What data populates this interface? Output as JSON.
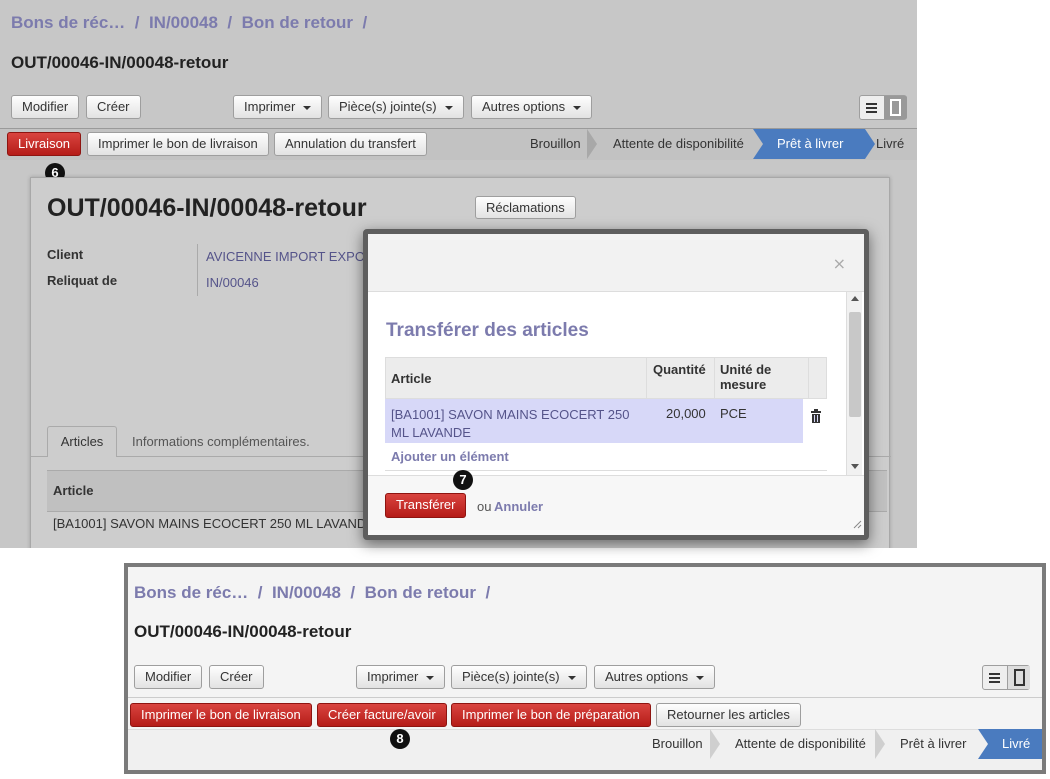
{
  "top": {
    "breadcrumb": [
      "Bons de réc…",
      "IN/00048",
      "Bon de retour"
    ],
    "record_title": "OUT/00046-IN/00048-retour",
    "buttons": {
      "modifier": "Modifier",
      "creer": "Créer",
      "imprimer": "Imprimer",
      "pieces": "Pièce(s) jointe(s)",
      "autres": "Autres options"
    },
    "actions": {
      "livraison": "Livraison",
      "imprimer_bon": "Imprimer le bon de livraison",
      "annulation": "Annulation du transfert"
    },
    "steps": [
      "Brouillon",
      "Attente de disponibilité",
      "Prêt à livrer",
      "Livré"
    ],
    "badge6": "6",
    "form": {
      "title": "OUT/00046-IN/00048-retour",
      "reclamations": "Réclamations",
      "client_label": "Client",
      "client_value": "AVICENNE IMPORT EXPOR",
      "reliquat_label": "Reliquat de",
      "reliquat_value": "IN/00046",
      "tabs": [
        "Articles",
        "Informations complémentaires."
      ],
      "table_header": "Article",
      "table_row": "[BA1001] SAVON MAINS ECOCERT 250 ML LAVAND"
    }
  },
  "modal": {
    "close": "×",
    "title": "Transférer des articles",
    "columns": {
      "article": "Article",
      "quantite": "Quantité",
      "unite1": "Unité de",
      "unite2": "mesure"
    },
    "row": {
      "article1": "[BA1001] SAVON MAINS ECOCERT 250",
      "article2": "ML LAVANDE",
      "quantite": "20,000",
      "unite": "PCE"
    },
    "add": "Ajouter un élément",
    "badge7": "7",
    "transferer": "Transférer",
    "ou": "ou",
    "annuler": "Annuler"
  },
  "bottom": {
    "breadcrumb": [
      "Bons de réc…",
      "IN/00048",
      "Bon de retour"
    ],
    "record_title": "OUT/00046-IN/00048-retour",
    "buttons": {
      "modifier": "Modifier",
      "creer": "Créer",
      "imprimer": "Imprimer",
      "pieces": "Pièce(s) jointe(s)",
      "autres": "Autres options"
    },
    "actions": {
      "imprimer_livraison": "Imprimer le bon de livraison",
      "creer_facture": "Créer facture/avoir",
      "imprimer_preparation": "Imprimer le bon de préparation",
      "retourner": "Retourner les articles"
    },
    "steps": [
      "Brouillon",
      "Attente de disponibilité",
      "Prêt à livrer",
      "Livré"
    ],
    "badge8": "8"
  },
  "colors": {
    "accent_red": "#c0221e",
    "breadcrumb": "#7c7bad",
    "active_step": "#4a7bbf",
    "selected_row": "#d7d8f8"
  }
}
